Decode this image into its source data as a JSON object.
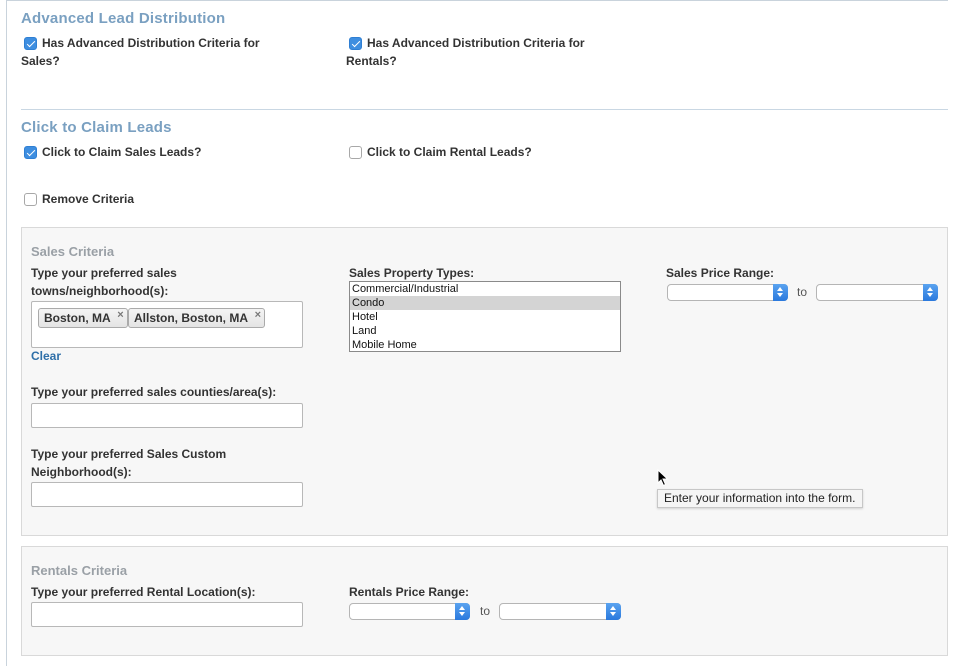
{
  "advanced": {
    "title": "Advanced Lead Distribution",
    "sales_checkbox_label_line1": "Has Advanced Distribution Criteria for",
    "sales_checkbox_label_line2": "Sales?",
    "sales_checked": true,
    "rentals_checkbox_label_line1": "Has Advanced Distribution Criteria for",
    "rentals_checkbox_label_line2": "Rentals?",
    "rentals_checked": true
  },
  "claim": {
    "title": "Click to Claim Leads",
    "sales_label": "Click to Claim Sales Leads?",
    "sales_checked": true,
    "rental_label": "Click to Claim Rental Leads?",
    "rental_checked": false,
    "remove_label": "Remove Criteria",
    "remove_checked": false
  },
  "sales_criteria": {
    "title": "Sales Criteria",
    "towns_label_line1": "Type your preferred sales",
    "towns_label_line2": "towns/neighborhood(s):",
    "tags": [
      "Boston, MA",
      "Allston, Boston, MA"
    ],
    "tag_remove_glyph": "×",
    "clear_label": "Clear",
    "counties_label": "Type your preferred sales counties/area(s):",
    "counties_value": "",
    "custom_label_line1": "Type your preferred Sales Custom",
    "custom_label_line2": "Neighborhood(s):",
    "custom_value": "",
    "property_types_label": "Sales Property Types:",
    "property_types": [
      "Commercial/Industrial",
      "Condo",
      "Hotel",
      "Land",
      "Mobile Home"
    ],
    "property_types_selected": "Condo",
    "price_label": "Sales Price Range:",
    "price_min": "",
    "price_max": "",
    "to_label": "to"
  },
  "rentals_criteria": {
    "title": "Rentals Criteria",
    "location_label": "Type your preferred Rental Location(s):",
    "location_value": "",
    "price_label": "Rentals Price Range:",
    "price_min": "",
    "price_max": "",
    "to_label": "to"
  },
  "tooltip": {
    "text": "Enter your information into the form."
  },
  "colors": {
    "section_title": "#7aa0c1",
    "checkbox_checked": "#3e8ee0",
    "link": "#2f6fa8",
    "panel_bg": "#f7f7f7"
  }
}
